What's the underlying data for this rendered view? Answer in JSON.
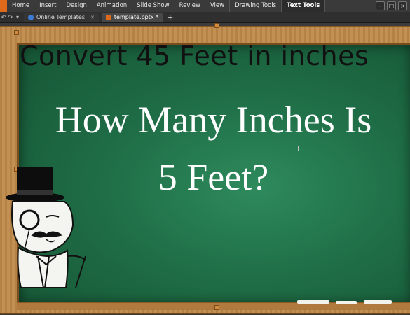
{
  "menu": {
    "items": [
      "Home",
      "Insert",
      "Design",
      "Animation",
      "Slide Show",
      "Review",
      "View",
      "Drawing Tools",
      "Text Tools"
    ],
    "active": "Text Tools"
  },
  "tabs": [
    {
      "label": "Online Templates",
      "active": false
    },
    {
      "label": "template.pptx *",
      "active": true
    }
  ],
  "slide": {
    "heading": "Convert 45 Feet in inches",
    "question_line1": "How Many Inches Is",
    "question_line2": "5 Feet?"
  },
  "colors": {
    "chalkboard": "#1f6e47",
    "frame": "#c08a4a",
    "accent": "#e06a1c"
  },
  "icons": [
    "online-templates-icon",
    "document-icon",
    "mustache-meme-image"
  ]
}
